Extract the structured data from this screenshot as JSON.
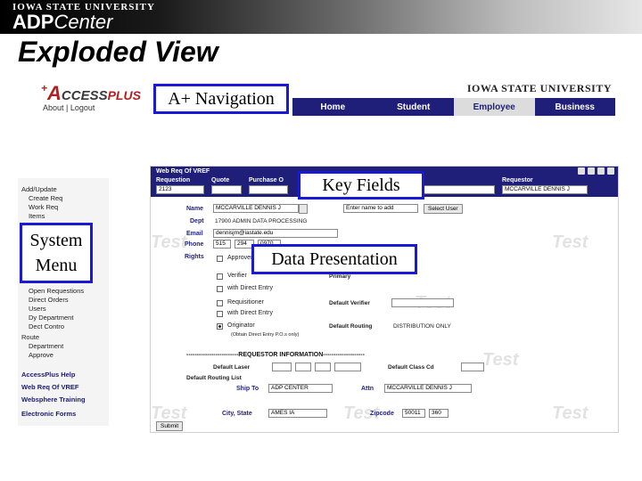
{
  "banner": {
    "university": "IOWA STATE UNIVERSITY",
    "adp": "ADP",
    "center": "Center"
  },
  "slide_title": "Exploded View",
  "navbar": {
    "logo_plus": "+",
    "logo_a": "A",
    "logo_ccess": "CCESS",
    "logo_plus_word": "PLUS",
    "logo_links": "About | Logout",
    "university": "IOWA STATE UNIVERSITY",
    "tabs": [
      "Home",
      "Student",
      "Employee",
      "Business"
    ]
  },
  "callouts": {
    "navigation": "A+ Navigation",
    "key_fields": "Key Fields",
    "system_menu_line1": "System",
    "system_menu_line2": "Menu",
    "data_presentation": "Data Presentation"
  },
  "system_menu": {
    "items_top": [
      "Add/Update",
      "Create Req",
      "Work Req",
      "Items"
    ],
    "items_mid": [
      "Open Requestions",
      "Direct Orders",
      "Users",
      "Dy Department",
      "Dect Contro",
      "Route",
      "Department",
      "Approve"
    ],
    "links": [
      "AccessPlus Help",
      "Web Req Of VREF",
      "Websphere Training",
      "Electronic Forms"
    ]
  },
  "app": {
    "title": "Web Req Of VREF",
    "header_labels": [
      "Requestion",
      "Quote",
      "Purchase O",
      "Requestor"
    ],
    "requestion_no": "2123",
    "requestor_val": "MCCARVILLE DENNIS J",
    "name_label": "Name",
    "name_val": "MCCARVILLE DENNIS J",
    "name_hint": "Enter name to add",
    "select_btn": "Select User",
    "dept_label": "Dept",
    "dept_val": "17900 ADMIN DATA PROCESSING",
    "email_label": "Email",
    "email_val": "dennisjm@iastate.edu",
    "phone_label": "Phone",
    "phone_vals": [
      "515",
      "294",
      "0970"
    ],
    "rights_label": "Rights",
    "rights": [
      "Approver",
      "Verifier",
      "with Direct Entry",
      "Requisitioner",
      "with Direct Entry",
      "Originator"
    ],
    "rights_note": "(Obtain Direct Entry P.O.s only)",
    "primary_label": "Primary",
    "default_verifier": "Default Verifier",
    "default_routing": "Default Routing",
    "routing_val": "DISTRIBUTION ONLY",
    "separator": "-------------------------REQUESTOR INFORMATION--------------------",
    "default_laser": "Default Laser",
    "default_class": "Default Class Cd",
    "default_routing_list": "Default Routing List",
    "ship_to_label": "Ship To",
    "ship_to_val": "ADP CENTER",
    "attn_label": "Attn",
    "attn_val": "MCCARVILLE DENNIS J",
    "city_label": "City, State",
    "city_val": "AMES IA",
    "zip_label": "Zipcode",
    "zip_vals": [
      "50011",
      "360"
    ],
    "submit": "Submit",
    "watermark": "Test"
  }
}
